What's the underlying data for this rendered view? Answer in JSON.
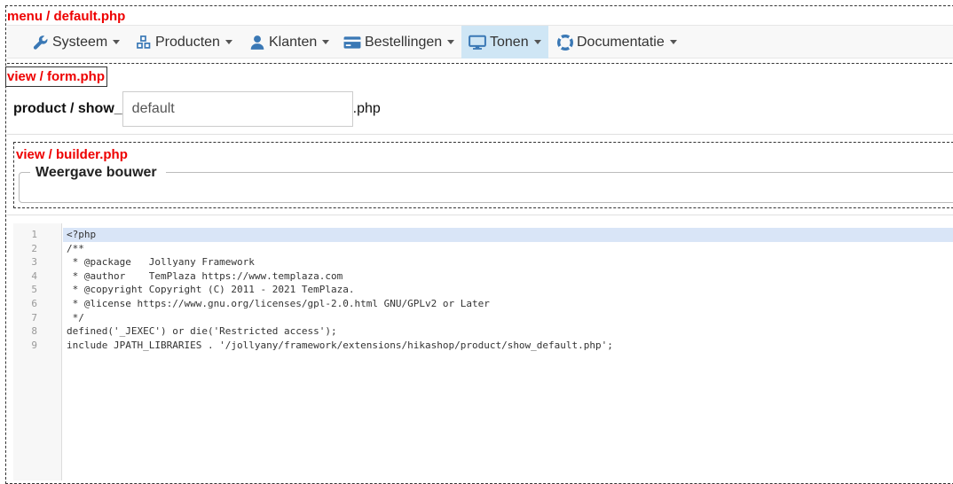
{
  "menu_label": "menu / default.php",
  "navbar": {
    "items": [
      {
        "label": "Systeem",
        "icon": "wrench-icon"
      },
      {
        "label": "Producten",
        "icon": "cubes-icon"
      },
      {
        "label": "Klanten",
        "icon": "user-icon"
      },
      {
        "label": "Bestellingen",
        "icon": "credit-card-icon"
      },
      {
        "label": "Tonen",
        "icon": "desktop-icon",
        "active": true
      },
      {
        "label": "Documentatie",
        "icon": "life-ring-icon"
      }
    ],
    "accent": "#3a78b5",
    "active_bg": "#cfe6f5"
  },
  "form_label": "view / form.php",
  "form": {
    "prefix": "product / show_",
    "input_value": "default",
    "suffix": ".php"
  },
  "builder_label": "view / builder.php",
  "builder": {
    "legend": "Weergave bouwer"
  },
  "editor": {
    "lines": [
      {
        "n": "1",
        "text": "<?php"
      },
      {
        "n": "2",
        "text": "/**"
      },
      {
        "n": "3",
        "text": " * @package   Jollyany Framework"
      },
      {
        "n": "4",
        "text": " * @author    TemPlaza https://www.templaza.com"
      },
      {
        "n": "5",
        "text": " * @copyright Copyright (C) 2011 - 2021 TemPlaza."
      },
      {
        "n": "6",
        "text": " * @license https://www.gnu.org/licenses/gpl-2.0.html GNU/GPLv2 or Later"
      },
      {
        "n": "7",
        "text": " */"
      },
      {
        "n": "8",
        "text": "defined('_JEXEC') or die('Restricted access');"
      },
      {
        "n": "9",
        "text": "include JPATH_LIBRARIES . '/jollyany/framework/extensions/hikashop/product/show_default.php';"
      }
    ],
    "active_line": "1"
  }
}
